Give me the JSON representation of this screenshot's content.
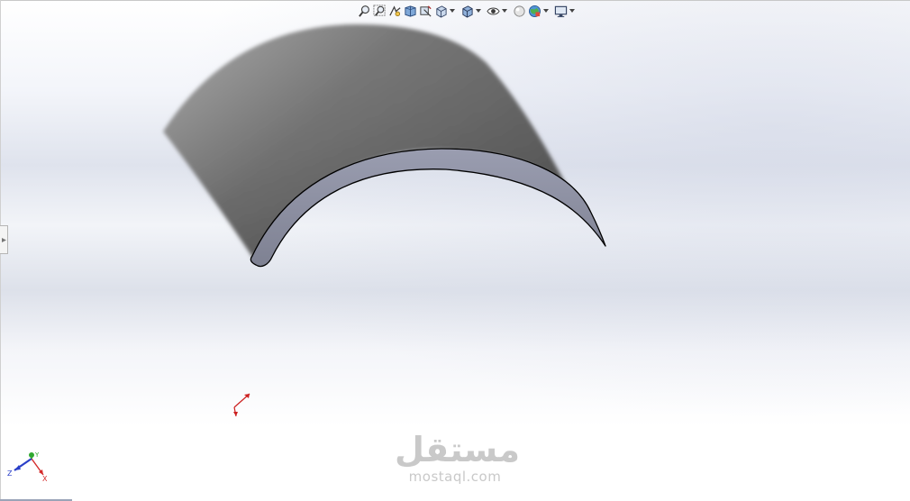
{
  "toolbar": {
    "tools": [
      {
        "icon": "zoom-to-fit-icon"
      },
      {
        "icon": "zoom-to-area-icon"
      },
      {
        "icon": "previous-view-icon"
      },
      {
        "icon": "section-view-icon"
      },
      {
        "icon": "dynamic-annotation-icon"
      },
      {
        "icon": "view-orientation-icon"
      },
      {
        "icon": "display-style-icon"
      },
      {
        "icon": "hide-show-items-icon"
      },
      {
        "icon": "edit-appearance-icon"
      },
      {
        "icon": "apply-scene-icon"
      },
      {
        "icon": "view-settings-icon"
      }
    ],
    "dropdown_icon": "chevron-down-icon"
  },
  "side_panel": {
    "icon": "expand-panel-icon"
  },
  "model": {
    "part": "curved-shell-part",
    "face_color": "#8c8f9c",
    "edge_color": "#000000",
    "surface_dark": "#5a5a5a",
    "surface_light": "#a2a2a2"
  },
  "axes": {
    "main_triad": {
      "x": "X",
      "y": "Y",
      "z": "Z"
    },
    "x_color": "#d42a2a",
    "y_color": "#2fa82f",
    "z_color": "#2a3fc8",
    "origin_color": "#cc1f1f"
  },
  "watermark": {
    "arabic": "مستقل",
    "latin": "mostaql.com"
  }
}
